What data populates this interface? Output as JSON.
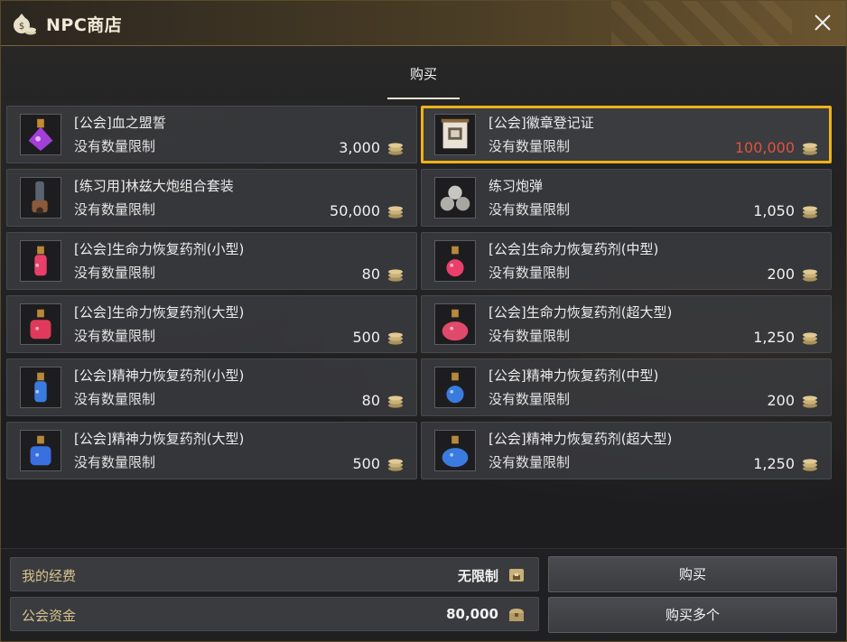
{
  "window": {
    "title": "NPC商店"
  },
  "tabs": {
    "buy": "购买"
  },
  "items": [
    {
      "name": "[公会]血之盟誓",
      "limit": "没有数量限制",
      "price": "3,000",
      "icon": "purple-potion-icon"
    },
    {
      "name": "[公会]徽章登记证",
      "limit": "没有数量限制",
      "price": "100,000",
      "icon": "scroll-certificate-icon",
      "selected": true
    },
    {
      "name": "[练习用]林兹大炮组合套装",
      "limit": "没有数量限制",
      "price": "50,000",
      "icon": "cannon-set-icon"
    },
    {
      "name": "练习炮弹",
      "limit": "没有数量限制",
      "price": "1,050",
      "icon": "cannonballs-icon"
    },
    {
      "name": "[公会]生命力恢复药剂(小型)",
      "limit": "没有数量限制",
      "price": "80",
      "icon": "red-potion-small-icon"
    },
    {
      "name": "[公会]生命力恢复药剂(中型)",
      "limit": "没有数量限制",
      "price": "200",
      "icon": "red-potion-medium-icon"
    },
    {
      "name": "[公会]生命力恢复药剂(大型)",
      "limit": "没有数量限制",
      "price": "500",
      "icon": "red-potion-large-icon"
    },
    {
      "name": "[公会]生命力恢复药剂(超大型)",
      "limit": "没有数量限制",
      "price": "1,250",
      "icon": "red-potion-xlarge-icon"
    },
    {
      "name": "[公会]精神力恢复药剂(小型)",
      "limit": "没有数量限制",
      "price": "80",
      "icon": "blue-potion-small-icon"
    },
    {
      "name": "[公会]精神力恢复药剂(中型)",
      "limit": "没有数量限制",
      "price": "200",
      "icon": "blue-potion-medium-icon"
    },
    {
      "name": "[公会]精神力恢复药剂(大型)",
      "limit": "没有数量限制",
      "price": "500",
      "icon": "blue-potion-large-icon"
    },
    {
      "name": "[公会]精神力恢复药剂(超大型)",
      "limit": "没有数量限制",
      "price": "1,250",
      "icon": "blue-potion-xlarge-icon"
    }
  ],
  "footer": {
    "my_funds_label": "我的经费",
    "my_funds_value": "无限制",
    "guild_funds_label": "公会资金",
    "guild_funds_value": "80,000",
    "buy_button": "购买",
    "buy_multiple_button": "购买多个"
  },
  "colors": {
    "selected_border": "#f0b21a",
    "selected_price": "#e0523f",
    "fund_label": "#d6c28d"
  }
}
